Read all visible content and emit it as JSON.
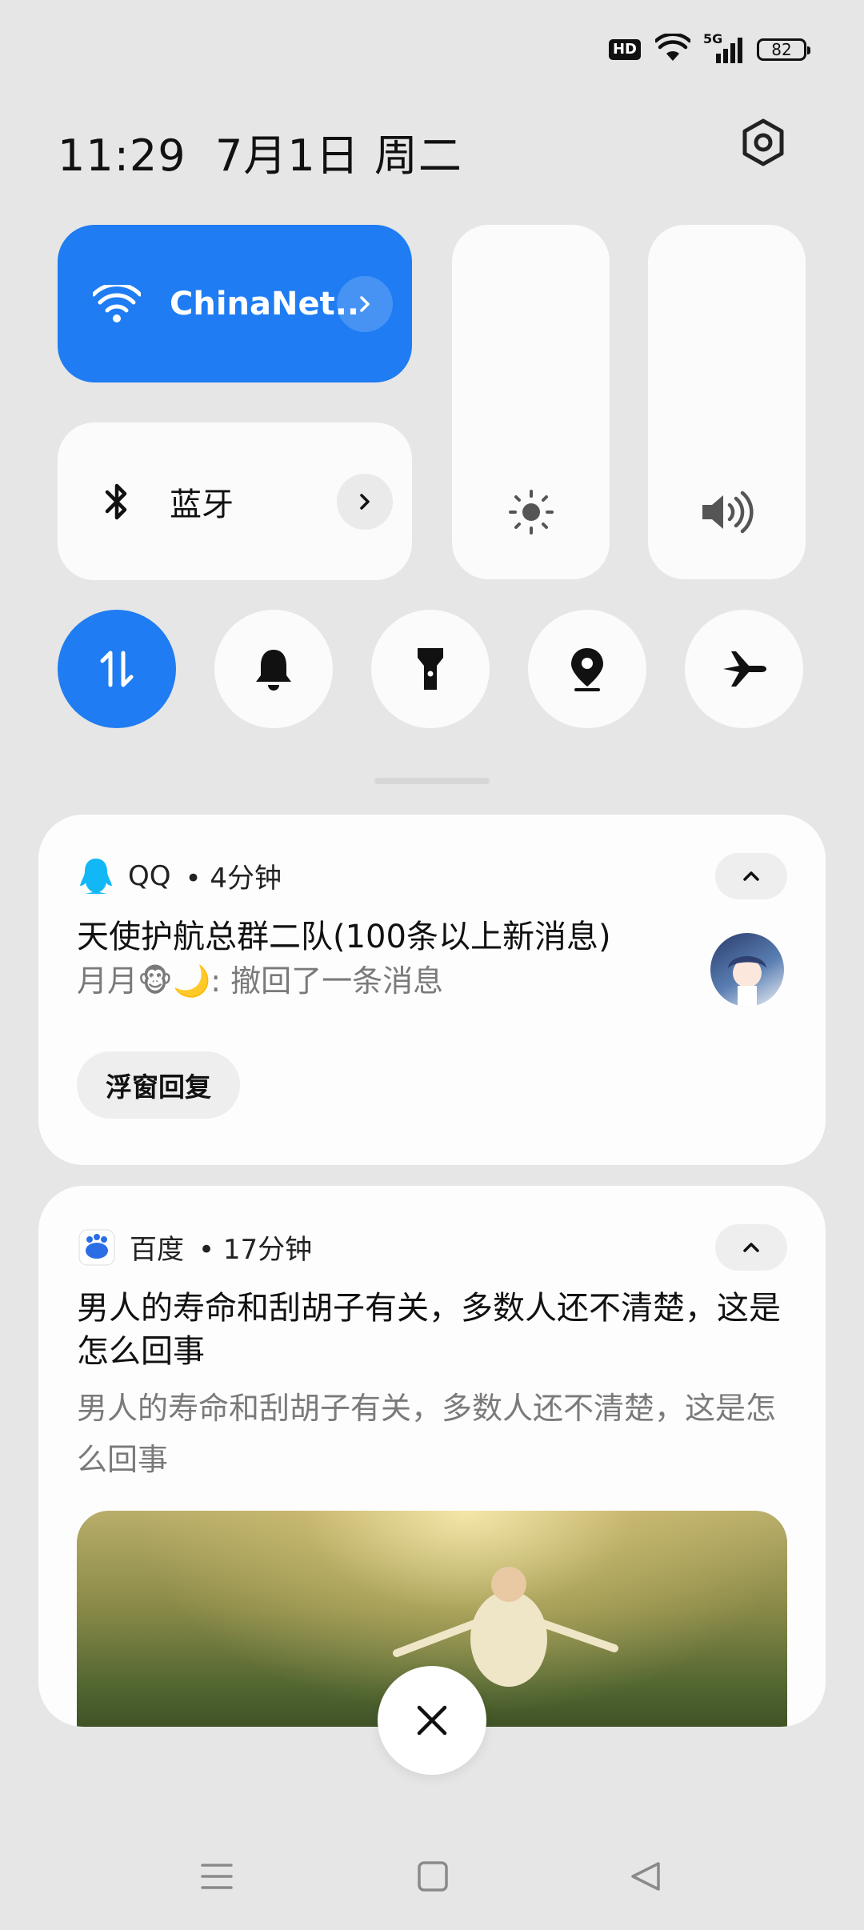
{
  "status_bar": {
    "hd_badge": "HD",
    "network_type": "5G",
    "battery_level": "82"
  },
  "header": {
    "time": "11:29",
    "date": "7月1日 周二"
  },
  "tiles": {
    "wifi": {
      "label": "ChinaNet.."
    },
    "bluetooth": {
      "label": "蓝牙"
    }
  },
  "toggles": [
    "mobile-data",
    "do-not-disturb",
    "flashlight",
    "location",
    "airplane-mode"
  ],
  "notifications": [
    {
      "app": "QQ",
      "time_ago": "• 4分钟",
      "title": "天使护航总群二队(100条以上新消息)",
      "body": "月月🐵🌙: 撤回了一条消息",
      "action": "浮窗回复"
    },
    {
      "app": "百度",
      "time_ago": "• 17分钟",
      "title": "男人的寿命和刮胡子有关，多数人还不清楚，这是怎么回事",
      "body": "男人的寿命和刮胡子有关，多数人还不清楚，这是怎么回事"
    }
  ],
  "colors": {
    "accent": "#1f7cf2",
    "background": "#e6e6e6",
    "card": "#fdfdfd"
  }
}
